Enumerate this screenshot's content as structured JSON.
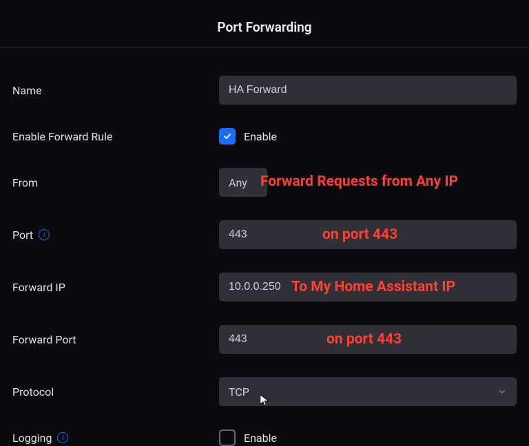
{
  "header": {
    "title": "Port Forwarding"
  },
  "labels": {
    "name": "Name",
    "enable_rule": "Enable Forward Rule",
    "from": "From",
    "port": "Port",
    "forward_ip": "Forward IP",
    "forward_port": "Forward Port",
    "protocol": "Protocol",
    "logging": "Logging"
  },
  "fields": {
    "name": "HA Forward",
    "enable_rule_checked": true,
    "enable_label": "Enable",
    "from": "Any",
    "port": "443",
    "forward_ip": "10.0.0.250",
    "forward_port": "443",
    "protocol": "TCP",
    "logging_checked": false,
    "logging_label": "Enable"
  },
  "annotations": {
    "from": "Forward Requests from Any IP",
    "port": "on port 443",
    "forward_ip": "To My Home Assistant IP",
    "forward_port": "on port 443"
  }
}
